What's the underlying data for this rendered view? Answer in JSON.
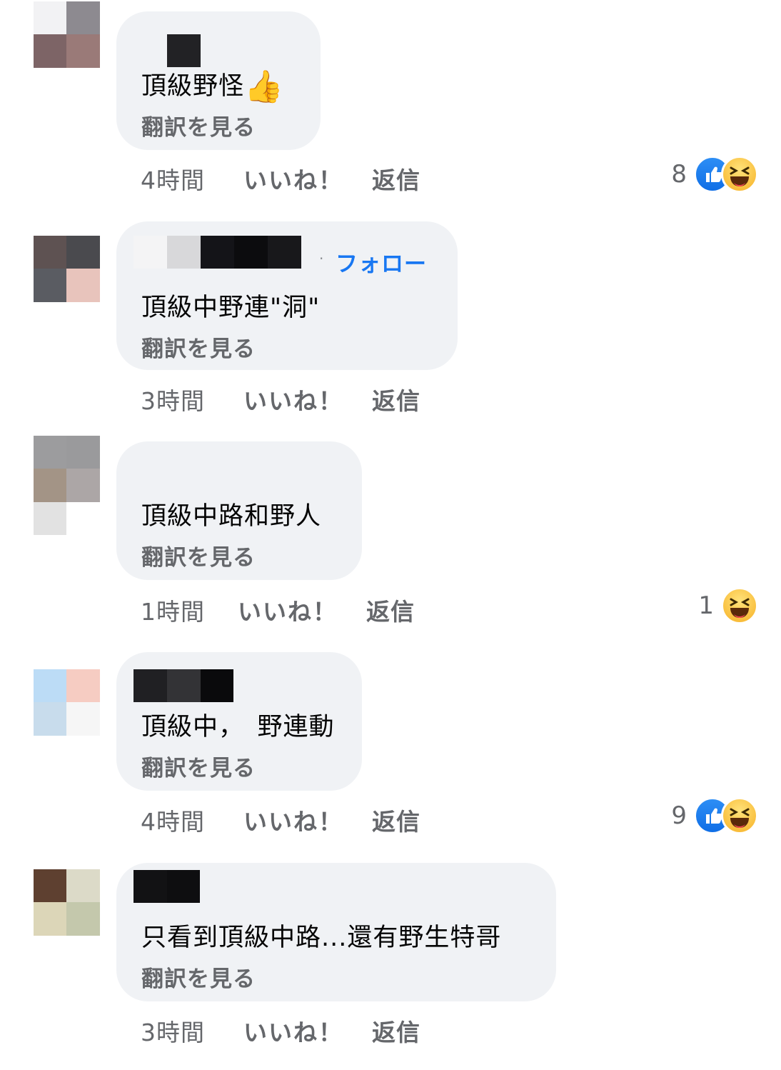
{
  "comments": [
    {
      "text": "頂級野怪",
      "translate_label": "翻訳を見る",
      "time": "4時間",
      "like_label": "いいね！",
      "reply_label": "返信",
      "reaction_count": "8",
      "reactions": [
        "like-icon",
        "haha-icon"
      ],
      "emoji": "👍"
    },
    {
      "follow_label": "フォロー",
      "text": "頂級中野連\"洞\"",
      "translate_label": "翻訳を見る",
      "time": "3時間",
      "like_label": "いいね！",
      "reply_label": "返信"
    },
    {
      "text": "頂級中路和野人",
      "translate_label": "翻訳を見る",
      "time": "1時間",
      "like_label": "いいね！",
      "reply_label": "返信",
      "reaction_count": "1",
      "reactions": [
        "haha-icon"
      ]
    },
    {
      "text": "頂級中，　野連動",
      "translate_label": "翻訳を見る",
      "time": "4時間",
      "like_label": "いいね！",
      "reply_label": "返信",
      "reaction_count": "9",
      "reactions": [
        "like-icon",
        "haha-icon"
      ]
    },
    {
      "text": "只看到頂級中路...還有野生特哥",
      "translate_label": "翻訳を見る",
      "time": "3時間",
      "like_label": "いいね！",
      "reply_label": "返信"
    }
  ],
  "colors": {
    "bubble": "#f0f2f5",
    "secondary_text": "#65676b",
    "link_blue": "#1877f2",
    "like_blue": "#1877f2",
    "haha_yellow": "#f7b125"
  }
}
